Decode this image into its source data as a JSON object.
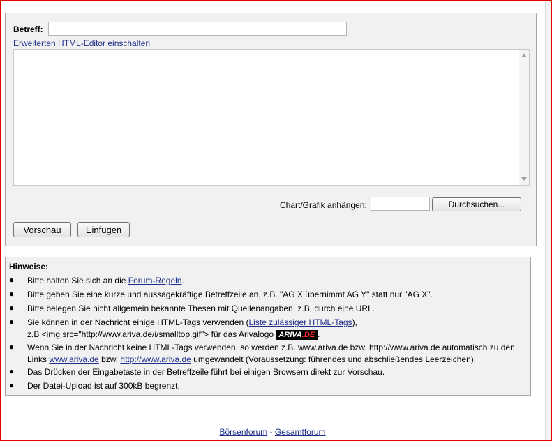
{
  "form": {
    "subject_label_underlined": "B",
    "subject_label_rest": "etreff:",
    "subject_value": "",
    "editor_link": "Erweiterten HTML-Editor einschalten",
    "message_value": "",
    "attach_label": "Chart/Grafik anhängen:",
    "browse_label": "Durchsuchen...",
    "preview_label": "Vorschau",
    "insert_label": "Einfügen"
  },
  "notes": {
    "title": "Hinweise:",
    "bullet": "●",
    "n1_text": "Bitte halten Sie sich an die ",
    "n1_link": "Forum-Regeln",
    "n1_end": ".",
    "n2_text": "Bitte geben Sie eine kurze und aussagekräftige Betreffzeile an, z.B. \"AG X übernimmt AG Y\" statt nur \"AG X\".",
    "n3_text": "Bitte belegen Sie nicht allgemein bekannte Thesen mit Quellenangaben, z.B. durch eine URL.",
    "n4_text": "Sie können in der Nachricht einige HTML-Tags verwenden (",
    "n4_link": "Liste zulässiger HTML-Tags",
    "n4_end": "),",
    "n4_line2": "z.B <img src=\"http://www.ariva.de/i/smalltop.gif\"> für das Arivalogo ",
    "n4_logo_a": "ARIVA",
    "n4_logo_b": ".DE",
    "n4_line2_end": ".",
    "n5_text": "Wenn Sie in der Nachricht keine HTML-Tags verwenden, so werden z.B. www.ariva.de bzw. http://www.ariva.de automatisch zu den Links ",
    "n5_link1": "www.ariva.de",
    "n5_mid": " bzw. ",
    "n5_link2": "http://www.ariva.de",
    "n5_end": " umgewandelt (Voraussetzung: führendes und abschließendes Leerzeichen).",
    "n6_text": "Das Drücken der Eingabetaste in der Betreffzeile führt bei einigen Browsern direkt zur Vorschau.",
    "n7_text": "Der Datei-Upload ist auf 300kB begrenzt."
  },
  "footer": {
    "link1": "Börsenforum",
    "sep": " - ",
    "link2": "Gesamtforum"
  },
  "colors": {
    "link": "#1f2f8c",
    "frame": "#e00000",
    "panel_bg": "#f1f1f1"
  }
}
